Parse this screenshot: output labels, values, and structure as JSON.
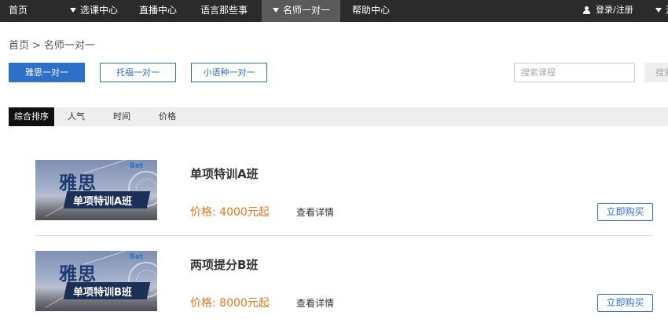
{
  "nav": {
    "items": [
      {
        "label": "首页",
        "caret": false,
        "active": false
      },
      {
        "label": "选课中心",
        "caret": true,
        "active": false
      },
      {
        "label": "直播中心",
        "caret": false,
        "active": false
      },
      {
        "label": "语言那些事",
        "caret": false,
        "active": false
      },
      {
        "label": "名师一对一",
        "caret": true,
        "active": true
      },
      {
        "label": "帮助中心",
        "caret": false,
        "active": false
      }
    ],
    "login_label": "登录/注册",
    "cut_label": "消"
  },
  "breadcrumb": {
    "home": "首页",
    "sep": ">",
    "current": "名师一对一"
  },
  "categories": [
    {
      "label": "雅思一对一",
      "active": true
    },
    {
      "label": "托福一对一",
      "active": false
    },
    {
      "label": "小语种一对一",
      "active": false
    }
  ],
  "search": {
    "placeholder": "搜索课程",
    "button_label": "搜索"
  },
  "sort": {
    "items": [
      {
        "label": "综合排序",
        "active": true
      },
      {
        "label": "人气",
        "active": false
      },
      {
        "label": "时间",
        "active": false
      },
      {
        "label": "价格",
        "active": false
      }
    ]
  },
  "courses": [
    {
      "name": "单项特训A班",
      "price": "价格: 4000元起",
      "detail": "查看详情",
      "buy": "立即购买",
      "thumb": {
        "title": "雅思",
        "band": "单项特训A班",
        "logo": "Bat"
      }
    },
    {
      "name": "两项提分B班",
      "price": "价格: 8000元起",
      "detail": "查看详情",
      "buy": "立即购买",
      "thumb": {
        "title": "雅思",
        "band": "单项特训B班",
        "logo": "Bat"
      }
    }
  ],
  "colors": {
    "accent": "#2e6fc7",
    "price": "#e8771c",
    "nav_bg": "#2b2b2b"
  }
}
